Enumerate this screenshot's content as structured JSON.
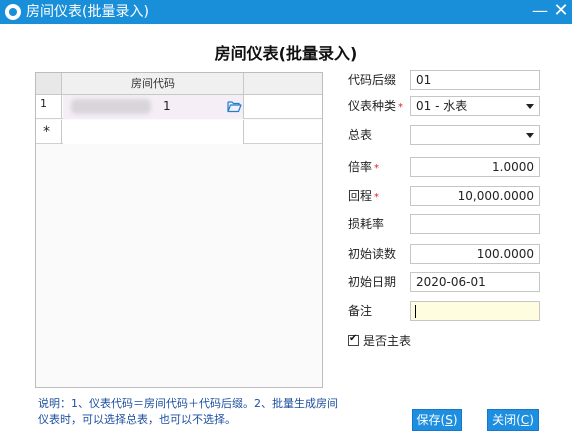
{
  "window": {
    "title": "房间仪表(批量录入)",
    "minimize_glyph": "—",
    "close_glyph": "✕",
    "accent_color": "#1a8fd9"
  },
  "form": {
    "title": "房间仪表(批量录入)"
  },
  "grid": {
    "column_header": "房间代码",
    "rows": [
      {
        "indicator": "1",
        "code_suffix": "1",
        "icon": "folder-icon"
      }
    ],
    "new_row_indicator": "*"
  },
  "fields": {
    "code_suffix": {
      "label": "代码后缀",
      "value": "01"
    },
    "meter_type": {
      "label": "仪表种类",
      "required_mark": "*",
      "value": "01 - 水表"
    },
    "main_meter": {
      "label": "总表",
      "value": ""
    },
    "multiplier": {
      "label": "倍率",
      "required_mark": "*",
      "value": "1.0000"
    },
    "rollover": {
      "label": "回程",
      "required_mark": "*",
      "value": "10,000.0000"
    },
    "loss_rate": {
      "label": "损耗率",
      "value": ""
    },
    "initial_reading": {
      "label": "初始读数",
      "value": "100.0000"
    },
    "initial_date": {
      "label": "初始日期",
      "value": "2020-06-01"
    },
    "note": {
      "label": "备注",
      "value": ""
    }
  },
  "is_main_meter": {
    "label": "是否主表",
    "checked": true,
    "check_glyph": "✔"
  },
  "hint_text": "说明：1、仪表代码＝房间代码＋代码后缀。2、批量生成房间仪表时，可以选择总表，也可以不选择。",
  "buttons": {
    "save": {
      "label": "保存(",
      "hotkey": "S",
      "suffix": ")"
    },
    "close": {
      "label": "关闭(",
      "hotkey": "C",
      "suffix": ")"
    }
  }
}
